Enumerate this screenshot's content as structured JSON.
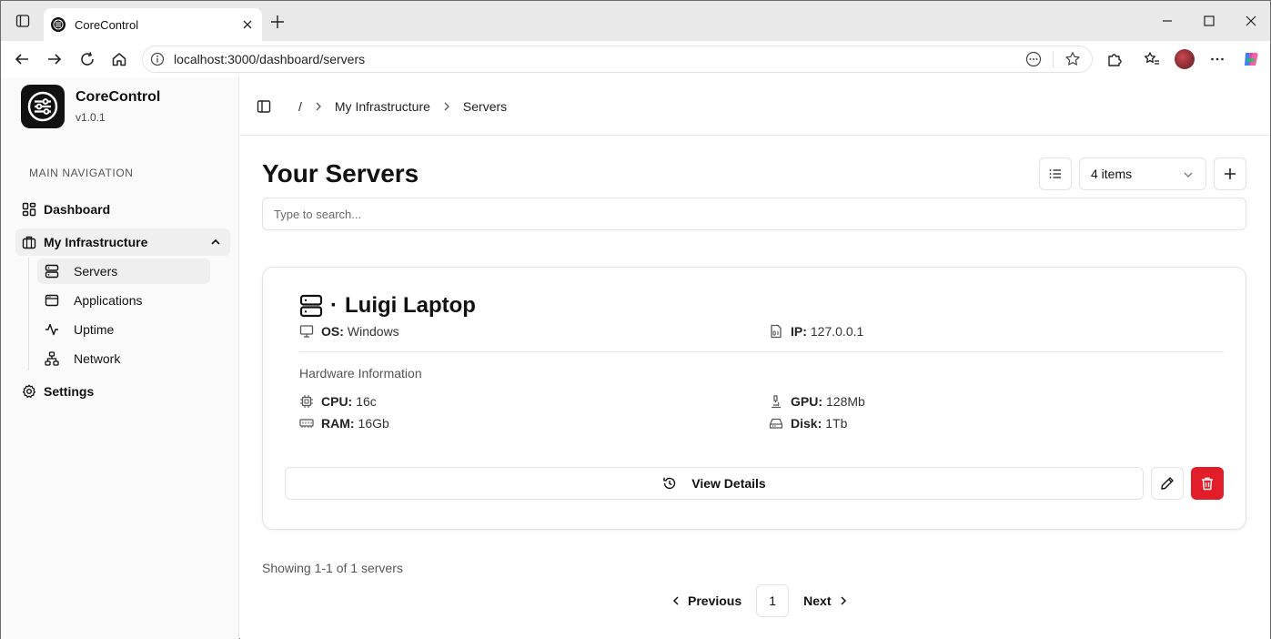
{
  "browser": {
    "tab_title": "CoreControl",
    "url": "localhost:3000/dashboard/servers"
  },
  "sidebar": {
    "app_name": "CoreControl",
    "version": "v1.0.1",
    "nav_heading": "MAIN NAVIGATION",
    "items": {
      "dashboard": "Dashboard",
      "infrastructure": "My Infrastructure",
      "servers": "Servers",
      "applications": "Applications",
      "uptime": "Uptime",
      "network": "Network",
      "settings": "Settings"
    }
  },
  "breadcrumb": {
    "root": "/",
    "parent": "My Infrastructure",
    "current": "Servers"
  },
  "page": {
    "title": "Your Servers",
    "items_select": "4 items",
    "search_placeholder": "Type to search..."
  },
  "server": {
    "name": "Luigi Laptop",
    "separator": "·",
    "os_label": "OS:",
    "os": "Windows",
    "ip_label": "IP:",
    "ip": "127.0.0.1",
    "hardware_heading": "Hardware Information",
    "cpu_label": "CPU:",
    "cpu": "16c",
    "gpu_label": "GPU:",
    "gpu": "128Mb",
    "ram_label": "RAM:",
    "ram": "16Gb",
    "disk_label": "Disk:",
    "disk": "1Tb",
    "view_details": "View Details"
  },
  "pagination": {
    "showing": "Showing 1-1 of 1 servers",
    "previous": "Previous",
    "page": "1",
    "next": "Next"
  },
  "colors": {
    "delete": "#e11d2a",
    "brand": "#111111"
  }
}
